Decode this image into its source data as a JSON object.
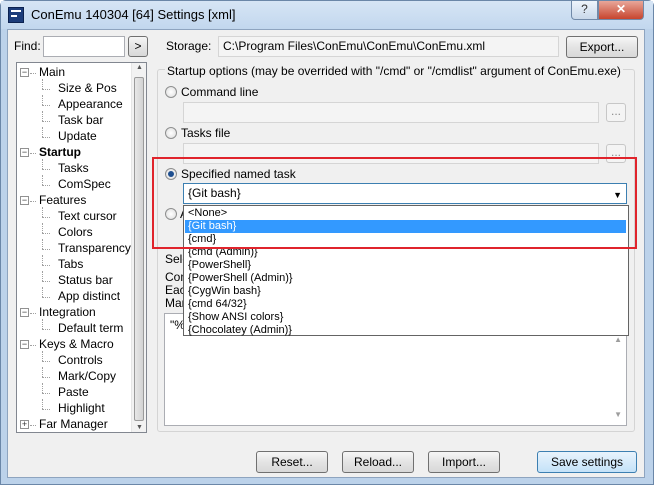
{
  "window": {
    "title": "ConEmu 140304 [64] Settings [xml]",
    "help_label": "?",
    "close_label": "✕"
  },
  "find": {
    "label": "Find:",
    "value": "",
    "go_label": ">"
  },
  "storage": {
    "label": "Storage:",
    "path": "C:\\Program Files\\ConEmu\\ConEmu\\ConEmu.xml",
    "export_label": "Export..."
  },
  "tree": [
    {
      "label": "Main",
      "level": 0,
      "expander": "minus",
      "bold": false
    },
    {
      "label": "Size & Pos",
      "level": 1,
      "bold": false
    },
    {
      "label": "Appearance",
      "level": 1,
      "bold": false
    },
    {
      "label": "Task bar",
      "level": 1,
      "bold": false
    },
    {
      "label": "Update",
      "level": 1,
      "bold": false
    },
    {
      "label": "Startup",
      "level": 0,
      "expander": "minus",
      "bold": true
    },
    {
      "label": "Tasks",
      "level": 1,
      "bold": false
    },
    {
      "label": "ComSpec",
      "level": 1,
      "bold": false
    },
    {
      "label": "Features",
      "level": 0,
      "expander": "minus",
      "bold": false
    },
    {
      "label": "Text cursor",
      "level": 1,
      "bold": false
    },
    {
      "label": "Colors",
      "level": 1,
      "bold": false
    },
    {
      "label": "Transparency",
      "level": 1,
      "bold": false
    },
    {
      "label": "Tabs",
      "level": 1,
      "bold": false
    },
    {
      "label": "Status bar",
      "level": 1,
      "bold": false
    },
    {
      "label": "App distinct",
      "level": 1,
      "bold": false
    },
    {
      "label": "Integration",
      "level": 0,
      "expander": "minus",
      "bold": false
    },
    {
      "label": "Default term",
      "level": 1,
      "bold": false
    },
    {
      "label": "Keys & Macro",
      "level": 0,
      "expander": "minus",
      "bold": false
    },
    {
      "label": "Controls",
      "level": 1,
      "bold": false
    },
    {
      "label": "Mark/Copy",
      "level": 1,
      "bold": false
    },
    {
      "label": "Paste",
      "level": 1,
      "bold": false
    },
    {
      "label": "Highlight",
      "level": 1,
      "bold": false
    },
    {
      "label": "Far Manager",
      "level": 0,
      "expander": "plus",
      "bold": false
    }
  ],
  "startup": {
    "group_label": "Startup options (may be overrided with \"/cmd\" or \"/cmdlist\" argument of ConEmu.exe)",
    "command_line_label": "Command line",
    "command_line_value": "",
    "tasks_file_label": "Tasks file",
    "tasks_file_value": "",
    "browse_label": "...",
    "named_task_label": "Specified named task",
    "named_task_value": "{Git bash}",
    "auto_fragment": "A",
    "partial_labels": [
      "Sele",
      "Com",
      "Each",
      "Mar",
      "\"%"
    ]
  },
  "dropdown_options": [
    "<None>",
    "{Git bash}",
    "{cmd}",
    "{cmd (Admin)}",
    "{PowerShell}",
    "{PowerShell (Admin)}",
    "{CygWin bash}",
    "{cmd 64/32}",
    "{Show ANSI colors}",
    "{Chocolatey (Admin)}"
  ],
  "dropdown_selected_index": 1,
  "buttons": {
    "reset": "Reset...",
    "reload": "Reload...",
    "import": "Import...",
    "save": "Save settings"
  },
  "colors": {
    "highlight_border": "#e0242c",
    "selection": "#3399ff",
    "title_bar": "#c2d7ee"
  }
}
